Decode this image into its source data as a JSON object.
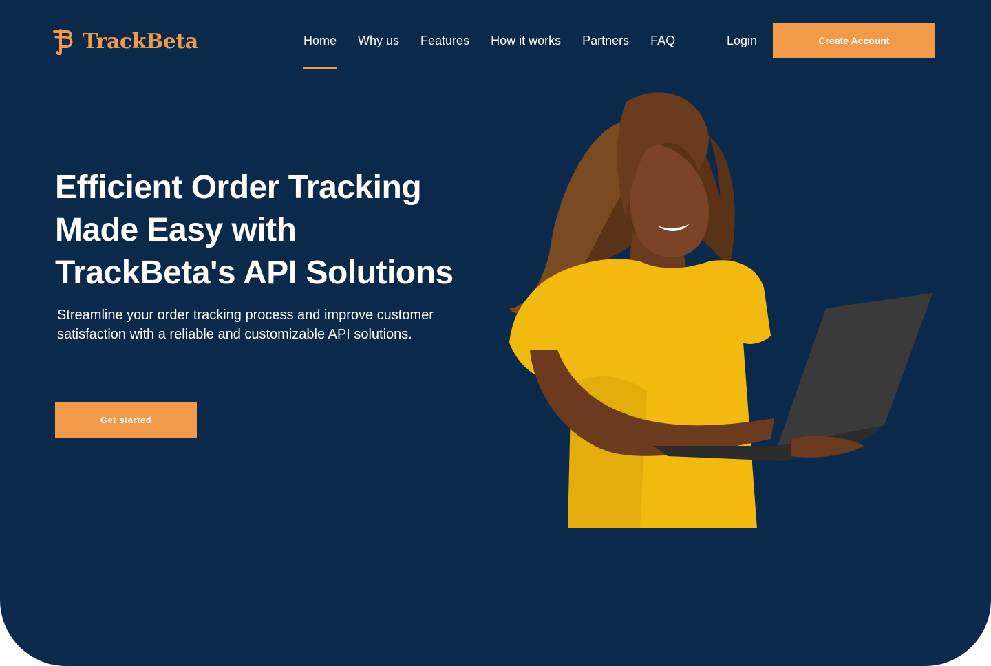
{
  "brand": {
    "name": "TrackBeta",
    "color": "#f29a4a"
  },
  "nav": {
    "items": [
      {
        "label": "Home",
        "active": true
      },
      {
        "label": "Why us",
        "active": false
      },
      {
        "label": "Features",
        "active": false
      },
      {
        "label": "How it works",
        "active": false
      },
      {
        "label": "Partners",
        "active": false
      },
      {
        "label": "FAQ",
        "active": false
      }
    ],
    "login_label": "Login",
    "create_account_label": "Create Account"
  },
  "hero": {
    "headline_lines": [
      "Efficient Order Tracking",
      "Made Easy with",
      "TrackBeta's API Solutions"
    ],
    "subtext": "Streamline your order tracking process and improve customer satisfaction with a reliable and customizable API solutions.",
    "cta_label": "Get started",
    "image_subject": "woman-with-laptop"
  },
  "colors": {
    "background": "#0b2a4b",
    "accent": "#f29a4a",
    "shirt": "#f2b90f",
    "laptop": "#3a3a3a"
  }
}
